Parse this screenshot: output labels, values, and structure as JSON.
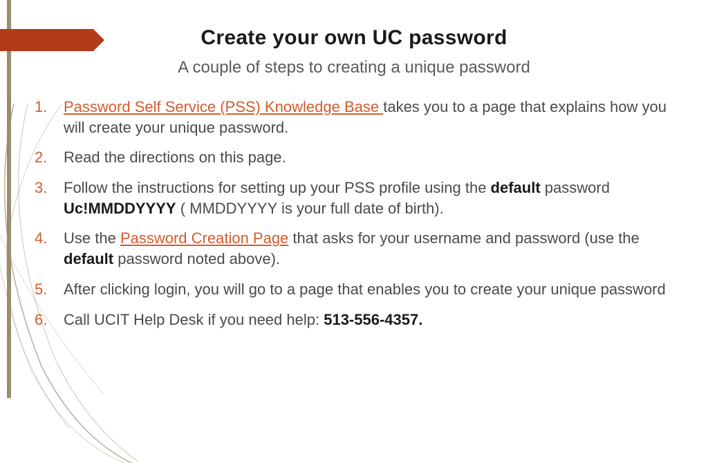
{
  "title": "Create your own UC password",
  "subtitle": "A couple of steps to creating a unique password",
  "items": [
    {
      "link": "Password Self Service (PSS) Knowledge Base ",
      "text_after": "takes you to a page that explains how you will create your unique password."
    },
    {
      "text": "Read the directions on this page."
    },
    {
      "text_before": "Follow the instructions for setting up your PSS profile using the ",
      "bold1": "default",
      "text_mid": " password ",
      "bold2": "Uc!MMDDYYYY",
      "text_after": " ( MMDDYYYY is your full date of birth)."
    },
    {
      "text_before": "Use the ",
      "link": "Password Creation Page",
      "text_mid": " that asks for your username and password (use the ",
      "bold1": "default",
      "text_after": " password noted above)."
    },
    {
      "text": "After clicking login, you will go to a page that enables you to create your unique password"
    },
    {
      "text_before": "Call UCIT Help Desk if you need help: ",
      "bold1": "513-556-4357."
    }
  ]
}
